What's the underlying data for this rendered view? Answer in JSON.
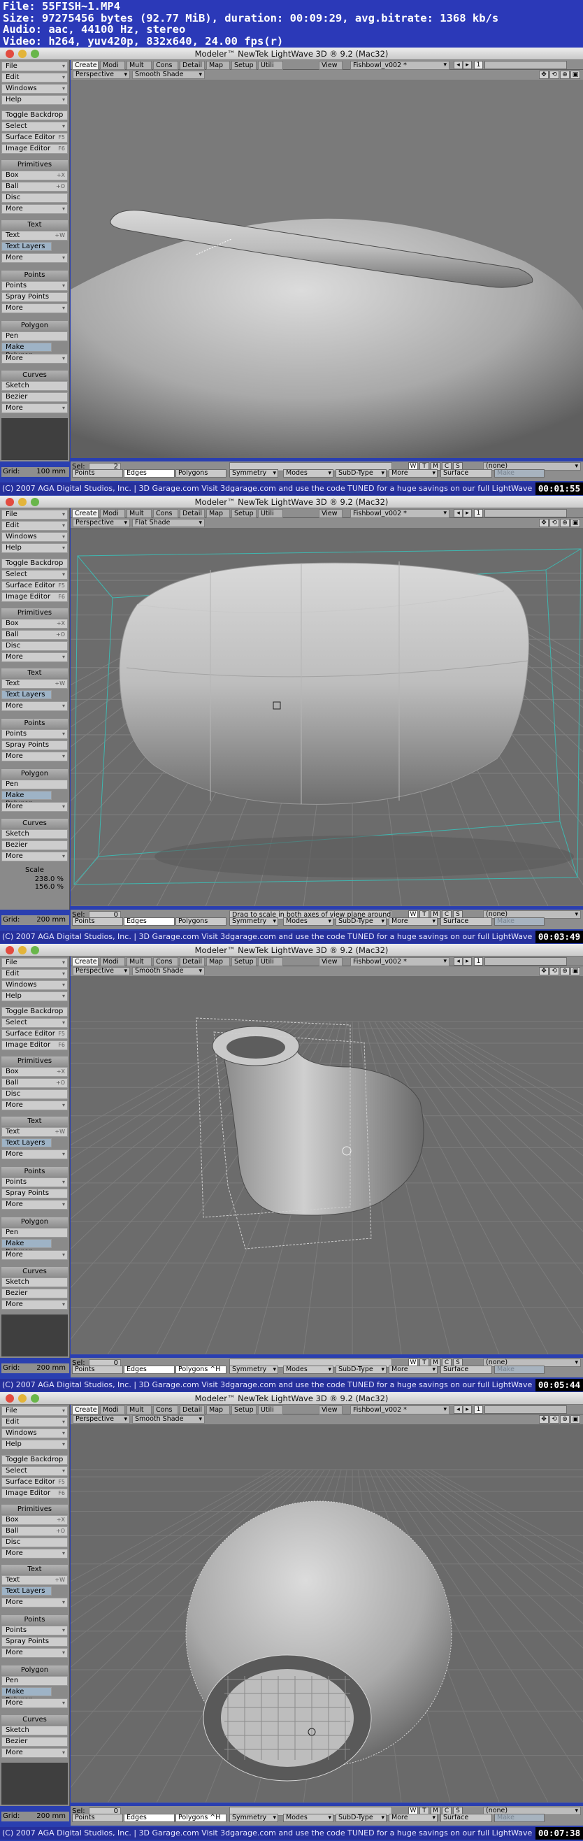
{
  "header": {
    "file": "File: 55FISH~1.MP4",
    "size": "Size: 97275456 bytes (92.77 MiB), duration: 00:09:29, avg.bitrate: 1368 kb/s",
    "audio": "Audio: aac, 44100 Hz, stereo",
    "video": "Video: h264, yuv420p, 832x640, 24.00 fps(r)"
  },
  "app_title": "Modeler™ NewTek LightWave 3D ® 9.2 (Mac32)",
  "tabs": [
    "Create",
    "Modi",
    "Mult",
    "Cons",
    "Detail",
    "Map",
    "Setup",
    "Utili",
    "View"
  ],
  "object_selector": "Fishbowl_v002 *",
  "layer_indicator": "1",
  "sidebar": {
    "file": "File",
    "edit": "Edit",
    "windows": "Windows",
    "help": "Help",
    "toggle_backdrop": "Toggle Backdrop",
    "select": "Select",
    "surface_editor": "Surface Editor",
    "surface_editor_sc": "F5",
    "image_editor": "Image Editor",
    "image_editor_sc": "F6",
    "primitives": "Primitives",
    "box": "Box",
    "box_sc": "+X",
    "ball": "Ball",
    "ball_sc": "+O",
    "disc": "Disc",
    "more": "More",
    "text_h": "Text",
    "text": "Text",
    "text_sc": "+W",
    "text_layers": "Text Layers",
    "points_h": "Points",
    "points": "Points",
    "spray_points": "Spray Points",
    "polygon_h": "Polygon",
    "pen": "Pen",
    "make_polygon": "Make Polygon",
    "curves_h": "Curves",
    "sketch": "Sketch",
    "bezier": "Bezier"
  },
  "viewport": {
    "view": "Perspective"
  },
  "bottombar": {
    "sel_label": "Sel:",
    "points": "Points",
    "edges": "Edges",
    "polygons": "Polygons",
    "symmetry": "Symmetry",
    "modes": "Modes",
    "subd": "SubD-Type",
    "more": "More",
    "surface": "Surface",
    "make": "Make",
    "none": "(none)",
    "grid_label": "Grid:",
    "wtabs": [
      "W",
      "T",
      "M",
      "C",
      "S"
    ]
  },
  "ticker": "(C) 2007  AGA Digital Studios, Inc.  |  3D Garage.com    Visit 3dgarage.com and use the code   TUNED    for a huge savings on our full LightWave",
  "frames": [
    {
      "render_mode": "Smooth Shade",
      "sel": "2",
      "grid": "100 mm",
      "polygons_label": "Polygons",
      "message": "",
      "timestamp": "00:01:55",
      "scale": null
    },
    {
      "render_mode": "Flat Shade",
      "sel": "0",
      "grid": "200 mm",
      "polygons_label": "Polygons",
      "message": "Drag to scale in both axes of view plane around i",
      "timestamp": "00:03:49",
      "scale": {
        "label": "Scale",
        "v1": "238.0 %",
        "v2": "156.0 %"
      }
    },
    {
      "render_mode": "Smooth Shade",
      "sel": "0",
      "grid": "200 mm",
      "polygons_label": "Polygons ^H",
      "message": "",
      "timestamp": "00:05:44",
      "scale": null
    },
    {
      "render_mode": "Smooth Shade",
      "sel": "0",
      "grid": "200 mm",
      "polygons_label": "Polygons ^H",
      "message": "",
      "timestamp": "00:07:38",
      "scale": null
    }
  ]
}
